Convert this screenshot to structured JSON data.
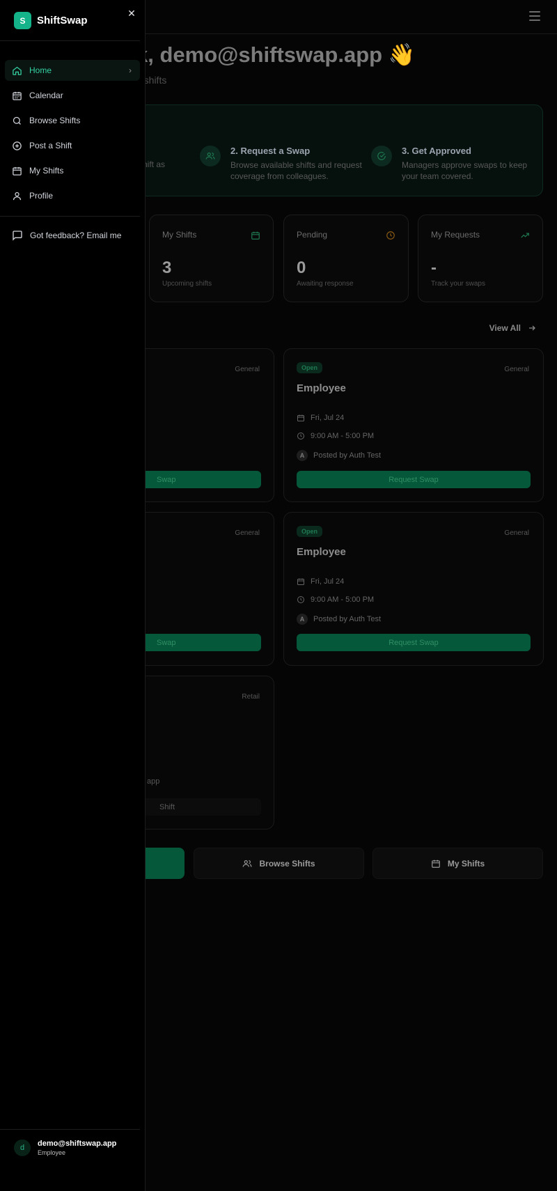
{
  "app": {
    "name": "ShiftSwap",
    "logo_letter": "S"
  },
  "sidebar": {
    "items": [
      {
        "label": "Home",
        "icon": "home-icon",
        "active": true
      },
      {
        "label": "Calendar",
        "icon": "calendar-icon"
      },
      {
        "label": "Browse Shifts",
        "icon": "search-icon"
      },
      {
        "label": "Post a Shift",
        "icon": "plus-circle-icon"
      },
      {
        "label": "My Shifts",
        "icon": "calendar-icon"
      },
      {
        "label": "Profile",
        "icon": "user-icon"
      }
    ],
    "feedback": "Got feedback? Email me",
    "user": {
      "initial": "d",
      "email": "demo@shiftswap.app",
      "role": "Employee"
    }
  },
  "main": {
    "greeting": "k, demo@shiftswap.app 👋",
    "greeting_sub": "ir shifts",
    "steps": [
      {
        "fragment": "hift as"
      },
      {
        "title": "2. Request a Swap",
        "desc": "Browse available shifts and request coverage from colleagues."
      },
      {
        "title": "3. Get Approved",
        "desc": "Managers approve swaps to keep your team covered."
      }
    ],
    "stats": [
      {
        "label": "My Shifts",
        "value": "3",
        "sub": "Upcoming shifts"
      },
      {
        "label": "Pending",
        "value": "0",
        "sub": "Awaiting response"
      },
      {
        "label": "My Requests",
        "value": "-",
        "sub": "Track your swaps"
      }
    ],
    "view_all": "View All",
    "cards_left": [
      {
        "category": "General",
        "button_fragment": "Swap"
      },
      {
        "category": "General",
        "button_fragment": "Swap"
      },
      {
        "category": "Retail",
        "email_fragment": "app",
        "button_fragment": "Shift"
      }
    ],
    "cards_right": [
      {
        "badge": "Open",
        "category": "General",
        "role": "Employee",
        "date": "Fri, Jul 24",
        "time": "9:00 AM - 5:00 PM",
        "poster_initial": "A",
        "posted_by": "Posted by Auth Test",
        "button": "Request Swap"
      },
      {
        "badge": "Open",
        "category": "General",
        "role": "Employee",
        "date": "Fri, Jul 24",
        "time": "9:00 AM - 5:00 PM",
        "poster_initial": "A",
        "posted_by": "Posted by Auth Test",
        "button": "Request Swap"
      }
    ],
    "quick_actions": [
      {
        "label": "Browse Shifts"
      },
      {
        "label": "My Shifts"
      }
    ]
  },
  "colors": {
    "accent": "#14b38a",
    "active_text": "#34d3a3",
    "button_green": "#06583a"
  }
}
